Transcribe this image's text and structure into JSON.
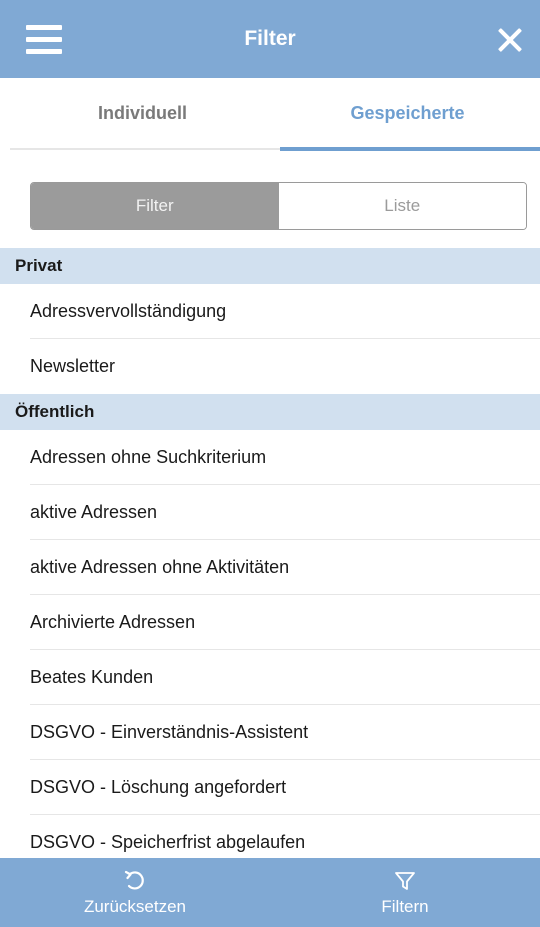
{
  "header": {
    "title": "Filter",
    "menu_icon": "hamburger-menu-icon",
    "close_icon": "close-icon"
  },
  "tabs": [
    {
      "label": "Individuell",
      "active": false
    },
    {
      "label": "Gespeicherte",
      "active": true
    }
  ],
  "segmented": {
    "filter_label": "Filter",
    "list_label": "Liste",
    "selected": "Filter"
  },
  "sections": [
    {
      "title": "Privat",
      "items": [
        "Adressvervollständigung",
        "Newsletter"
      ]
    },
    {
      "title": "Öffentlich",
      "items": [
        "Adressen ohne Suchkriterium",
        "aktive Adressen",
        "aktive Adressen ohne Aktivitäten",
        "Archivierte Adressen",
        "Beates Kunden",
        "DSGVO - Einverständnis-Assistent",
        "DSGVO - Löschung angefordert",
        "DSGVO - Speicherfrist abgelaufen"
      ]
    }
  ],
  "bottom_bar": {
    "reset_label": "Zurücksetzen",
    "reset_icon": "undo-icon",
    "filter_label": "Filtern",
    "filter_icon": "funnel-icon"
  },
  "colors": {
    "accent": "#80a9d4",
    "tab_active": "#6f9fd0",
    "section_bg": "#d1e0ef",
    "segment_active": "#9b9b9b"
  }
}
